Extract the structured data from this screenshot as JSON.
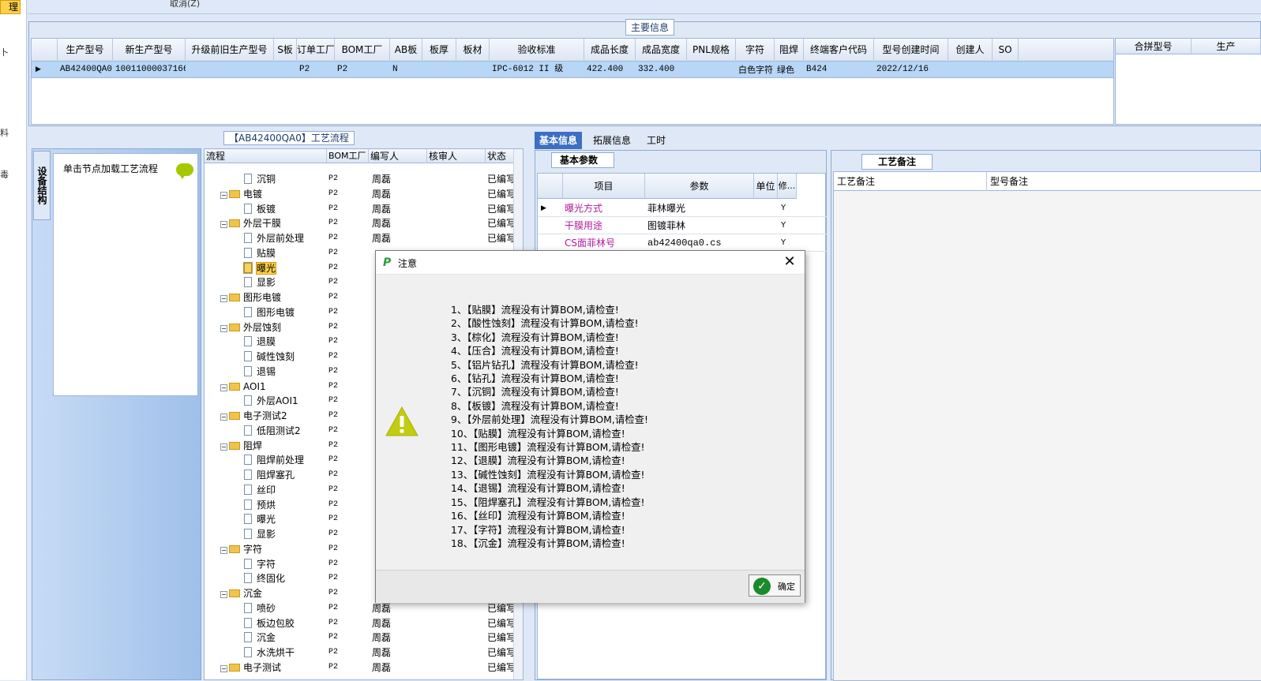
{
  "left_strip": {
    "tab_text": "理",
    "fragments": [
      "卜",
      "料",
      "毒"
    ]
  },
  "toolbar": {
    "cancel_text": "取消(Z)"
  },
  "main_info": {
    "title": "主要信息",
    "columns": [
      "生产型号",
      "新生产型号",
      "升级前旧生产型号",
      "S板",
      "订单工厂",
      "BOM工厂",
      "AB板",
      "板厚",
      "板材",
      "验收标准",
      "成品长度",
      "成品宽度",
      "PNL规格",
      "字符",
      "阻焊",
      "终端客户代码",
      "型号创建时间",
      "创建人",
      "SO"
    ],
    "row": [
      "AB42400QA0",
      "10011000037166",
      "",
      "",
      "P2",
      "P2",
      "N",
      "",
      "",
      "IPC-6012 II 级",
      "422.400",
      "332.400",
      "",
      "白色字符",
      "绿色",
      "B424",
      "2022/12/16",
      "",
      ""
    ],
    "merge_columns": [
      "合拼型号",
      "生产"
    ]
  },
  "structure": {
    "vtab": "设备结构",
    "hint": "单击节点加载工艺流程"
  },
  "flow": {
    "title": "【AB42400QA0】工艺流程",
    "headers": [
      "流程",
      "BOM工厂",
      "编写人",
      "核审人",
      "状态"
    ],
    "rows": [
      {
        "level": 1,
        "type": "doc",
        "name": "沉铜",
        "bom": "P2",
        "writer": "周磊",
        "status": "已编写"
      },
      {
        "level": 0,
        "type": "folder",
        "name": "电镀",
        "bom": "P2",
        "writer": "周磊",
        "status": "已编写"
      },
      {
        "level": 1,
        "type": "doc",
        "name": "板镀",
        "bom": "P2",
        "writer": "周磊",
        "status": "已编写"
      },
      {
        "level": 0,
        "type": "folder",
        "name": "外层干膜",
        "bom": "P2",
        "writer": "周磊",
        "status": "已编写"
      },
      {
        "level": 1,
        "type": "doc",
        "name": "外层前处理",
        "bom": "P2",
        "writer": "周磊",
        "status": "已编写"
      },
      {
        "level": 1,
        "type": "doc",
        "name": "贴膜",
        "bom": "P2",
        "writer": "",
        "status": ""
      },
      {
        "level": 1,
        "type": "doc",
        "name": "曝光",
        "bom": "P2",
        "writer": "",
        "status": "",
        "selected": true
      },
      {
        "level": 1,
        "type": "doc",
        "name": "显影",
        "bom": "P2",
        "writer": "",
        "status": ""
      },
      {
        "level": 0,
        "type": "folder",
        "name": "图形电镀",
        "bom": "P2",
        "writer": "",
        "status": ""
      },
      {
        "level": 1,
        "type": "doc",
        "name": "图形电镀",
        "bom": "P2",
        "writer": "",
        "status": ""
      },
      {
        "level": 0,
        "type": "folder",
        "name": "外层蚀刻",
        "bom": "P2",
        "writer": "",
        "status": ""
      },
      {
        "level": 1,
        "type": "doc",
        "name": "退膜",
        "bom": "P2",
        "writer": "",
        "status": ""
      },
      {
        "level": 1,
        "type": "doc",
        "name": "碱性蚀刻",
        "bom": "P2",
        "writer": "",
        "status": ""
      },
      {
        "level": 1,
        "type": "doc",
        "name": "退锡",
        "bom": "P2",
        "writer": "",
        "status": ""
      },
      {
        "level": 0,
        "type": "folder",
        "name": "AOI1",
        "bom": "P2",
        "writer": "",
        "status": ""
      },
      {
        "level": 1,
        "type": "doc",
        "name": "外层AOI1",
        "bom": "P2",
        "writer": "",
        "status": ""
      },
      {
        "level": 0,
        "type": "folder",
        "name": "电子测试2",
        "bom": "P2",
        "writer": "",
        "status": ""
      },
      {
        "level": 1,
        "type": "doc",
        "name": "低阻测试2",
        "bom": "P2",
        "writer": "",
        "status": ""
      },
      {
        "level": 0,
        "type": "folder",
        "name": "阻焊",
        "bom": "P2",
        "writer": "",
        "status": ""
      },
      {
        "level": 1,
        "type": "doc",
        "name": "阻焊前处理",
        "bom": "P2",
        "writer": "",
        "status": ""
      },
      {
        "level": 1,
        "type": "doc",
        "name": "阻焊塞孔",
        "bom": "P2",
        "writer": "",
        "status": ""
      },
      {
        "level": 1,
        "type": "doc",
        "name": "丝印",
        "bom": "P2",
        "writer": "",
        "status": ""
      },
      {
        "level": 1,
        "type": "doc",
        "name": "预烘",
        "bom": "P2",
        "writer": "",
        "status": ""
      },
      {
        "level": 1,
        "type": "doc",
        "name": "曝光",
        "bom": "P2",
        "writer": "",
        "status": ""
      },
      {
        "level": 1,
        "type": "doc",
        "name": "显影",
        "bom": "P2",
        "writer": "",
        "status": ""
      },
      {
        "level": 0,
        "type": "folder",
        "name": "字符",
        "bom": "P2",
        "writer": "",
        "status": ""
      },
      {
        "level": 1,
        "type": "doc",
        "name": "字符",
        "bom": "P2",
        "writer": "",
        "status": ""
      },
      {
        "level": 1,
        "type": "doc",
        "name": "终固化",
        "bom": "P2",
        "writer": "",
        "status": ""
      },
      {
        "level": 0,
        "type": "folder",
        "name": "沉金",
        "bom": "P2",
        "writer": "",
        "status": ""
      },
      {
        "level": 1,
        "type": "doc",
        "name": "喷砂",
        "bom": "P2",
        "writer": "周磊",
        "status": "已编写"
      },
      {
        "level": 1,
        "type": "doc",
        "name": "板边包胶",
        "bom": "P2",
        "writer": "周磊",
        "status": "已编写"
      },
      {
        "level": 1,
        "type": "doc",
        "name": "沉金",
        "bom": "P2",
        "writer": "周磊",
        "status": "已编写"
      },
      {
        "level": 1,
        "type": "doc",
        "name": "水洗烘干",
        "bom": "P2",
        "writer": "周磊",
        "status": "已编写"
      },
      {
        "level": 0,
        "type": "folder",
        "name": "电子测试",
        "bom": "P2",
        "writer": "周磊",
        "status": "已编写"
      }
    ]
  },
  "tabs": [
    "基本信息",
    "拓展信息",
    "工时"
  ],
  "basic": {
    "subtab": "基本参数",
    "headers": [
      "项目",
      "参数",
      "单位",
      "修..."
    ],
    "rows": [
      {
        "name": "曝光方式",
        "value": "菲林曝光",
        "unit": "",
        "mod": "Y"
      },
      {
        "name": "干膜用途",
        "value": "图镀菲林",
        "unit": "",
        "mod": "Y"
      },
      {
        "name": "CS面菲林号",
        "value": "ab42400qa0.cs",
        "unit": "",
        "mod": "Y"
      }
    ]
  },
  "remarks": {
    "subtab": "工艺备注",
    "headers": [
      "工艺备注",
      "型号备注"
    ]
  },
  "dialog": {
    "title": "注意",
    "close": "✕",
    "ok": "确定",
    "messages": [
      "1、【贴膜】流程没有计算BOM,请检查!",
      "2、【酸性蚀刻】流程没有计算BOM,请检查!",
      "3、【棕化】流程没有计算BOM,请检查!",
      "4、【压合】流程没有计算BOM,请检查!",
      "5、【铝片钻孔】流程没有计算BOM,请检查!",
      "6、【钻孔】流程没有计算BOM,请检查!",
      "7、【沉铜】流程没有计算BOM,请检查!",
      "8、【板镀】流程没有计算BOM,请检查!",
      "9、【外层前处理】流程没有计算BOM,请检查!",
      "10、【贴膜】流程没有计算BOM,请检查!",
      "11、【图形电镀】流程没有计算BOM,请检查!",
      "12、【退膜】流程没有计算BOM,请检查!",
      "13、【碱性蚀刻】流程没有计算BOM,请检查!",
      "14、【退锡】流程没有计算BOM,请检查!",
      "15、【阻焊塞孔】流程没有计算BOM,请检查!",
      "16、【丝印】流程没有计算BOM,请检查!",
      "17、【字符】流程没有计算BOM,请检查!",
      "18、【沉金】流程没有计算BOM,请检查!"
    ]
  }
}
